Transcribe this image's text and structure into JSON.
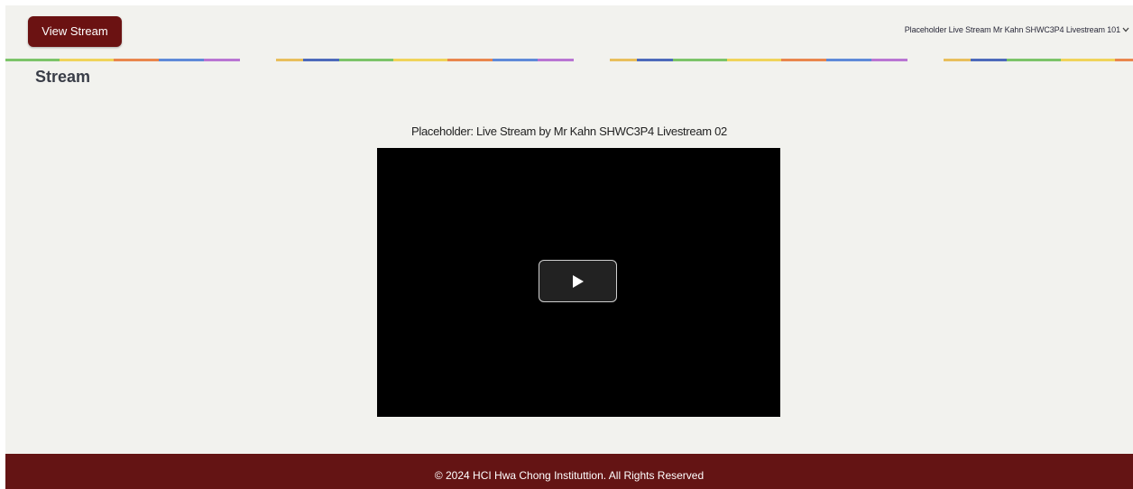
{
  "header": {
    "view_stream_label": "View Stream",
    "user_info": "Placeholder Live Stream Mr Kahn SHWC3P4 Livestream 101"
  },
  "main": {
    "section_title": "Stream",
    "stream_title": "Placeholder: Live Stream by Mr Kahn SHWC3P4 Livestream 02"
  },
  "icons": {
    "play": "play-icon",
    "dropdown": "chevron-down-icon"
  },
  "footer": {
    "copyright": "© 2024 HCI Hwa Chong Instituttion. All Rights Reserved"
  },
  "colors": {
    "brand": "#6b1212",
    "footer": "#641414",
    "background": "#f2f2ee"
  }
}
